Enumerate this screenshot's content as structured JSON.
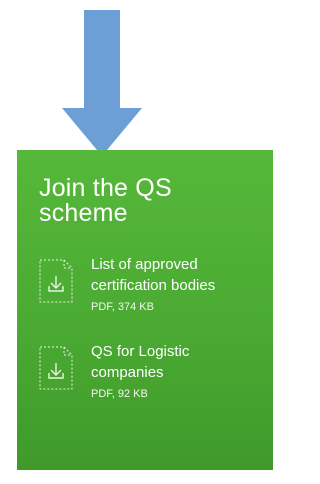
{
  "arrow": {
    "icon": "down-arrow-icon",
    "color": "#6b9fd6"
  },
  "panel": {
    "title_line1": "Join the QS",
    "title_line2": "scheme",
    "color": "#4caf34"
  },
  "downloads": [
    {
      "name_line1": "List of approved",
      "name_line2": "certification bodies",
      "meta": "PDF, 374 KB",
      "icon": "pdf-download-icon"
    },
    {
      "name_line1": "QS for Logistic",
      "name_line2": "companies",
      "meta": "PDF, 92 KB",
      "icon": "pdf-download-icon"
    }
  ]
}
